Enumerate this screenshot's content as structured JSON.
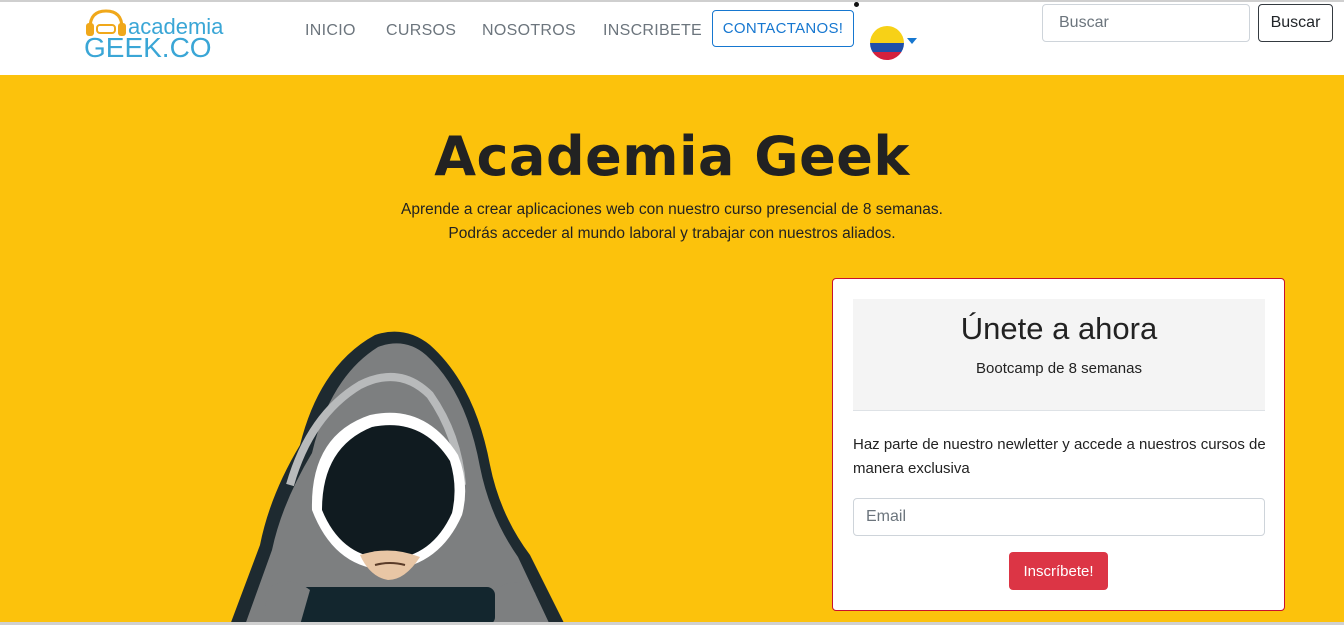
{
  "logo": {
    "line1": "academia",
    "line2": "GEEK.CO"
  },
  "nav": {
    "items": [
      "INICIO",
      "CURSOS",
      "NOSOTROS",
      "INSCRIBETE"
    ],
    "contact_label": "CONTACTANOS!"
  },
  "search": {
    "placeholder": "Buscar",
    "button_label": "Buscar"
  },
  "hero": {
    "title": "Academia Geek",
    "subtitle_line1": "Aprende a crear aplicaciones web con nuestro curso presencial de 8 semanas.",
    "subtitle_line2": "Podrás acceder al mundo laboral y trabajar con nuestros aliados."
  },
  "signup": {
    "title": "Únete a ahora",
    "subtitle": "Bootcamp de 8 semanas",
    "text": "Haz parte de nuestro newletter y accede a nuestros cursos de manera exclusiva",
    "email_placeholder": "Email",
    "button_label": "Inscríbete!"
  },
  "colors": {
    "hero_bg": "#fcc20c",
    "accent": "#1677d0",
    "danger": "#dc3545"
  },
  "icons": {
    "language": "colombia-flag-icon",
    "logo": "headphones-icon"
  }
}
